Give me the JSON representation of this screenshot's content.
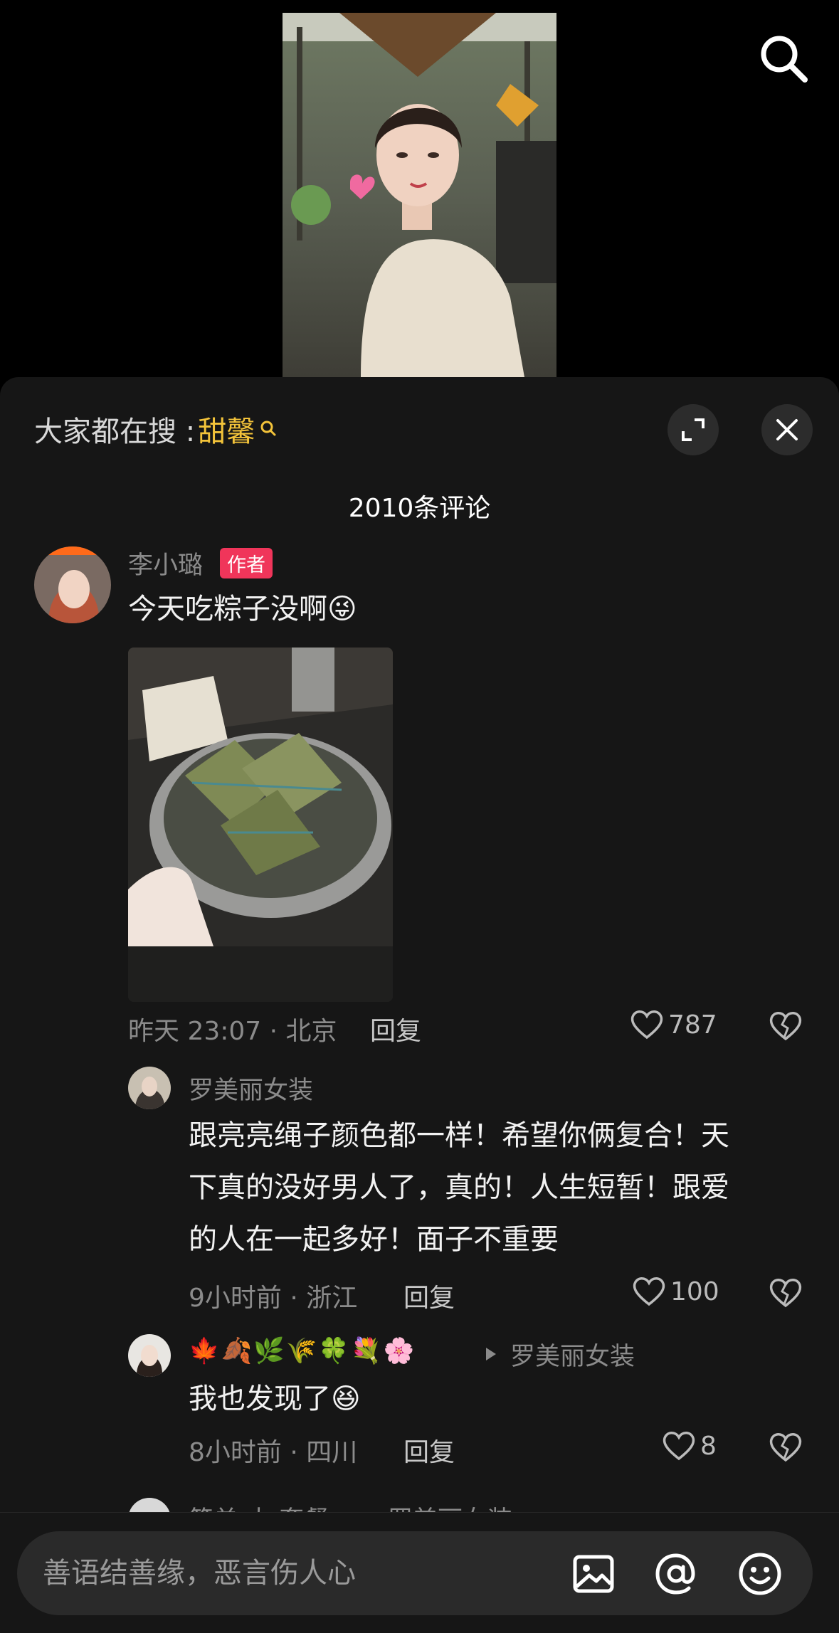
{
  "hot_search": {
    "prefix": "大家都在搜 : ",
    "keyword": "甜馨"
  },
  "comments_count": "2010条评论",
  "comments": [
    {
      "name": "李小璐",
      "author_tag": "作者",
      "text": "今天吃粽子没啊😜",
      "time_location": "昨天 23:07 · 北京",
      "reply": "回复",
      "likes": "787"
    },
    {
      "name": "罗美丽女装",
      "text_lines": [
        "跟亮亮绳子颜色都一样！希望你俩复合！天",
        "下真的没好男人了，真的！人生短暂！跟爱",
        "的人在一起多好！面子不重要"
      ],
      "time_location": "9小时前 · 浙江",
      "reply": "回复",
      "likes": "100"
    },
    {
      "name": "🍁🍂🌿🌾🍀💐🌸",
      "reply_to": "罗美丽女装",
      "text": "我也发现了😆",
      "time_location": "8小时前 · 四川",
      "reply": "回复",
      "likes": "8"
    },
    {
      "name": "简单 大 套餐",
      "reply_to": "罗美丽女装"
    }
  ],
  "input": {
    "placeholder": "善语结善缘，恶言伤人心"
  },
  "icons": {
    "top": "search-icon",
    "header": [
      "expand-icon",
      "close-icon"
    ],
    "bottom": [
      "image-icon",
      "at-icon",
      "emoji-icon"
    ]
  },
  "colors": {
    "keyword": "#f3c33a",
    "author_tag": "#f0355a",
    "sheet": "#161616"
  }
}
